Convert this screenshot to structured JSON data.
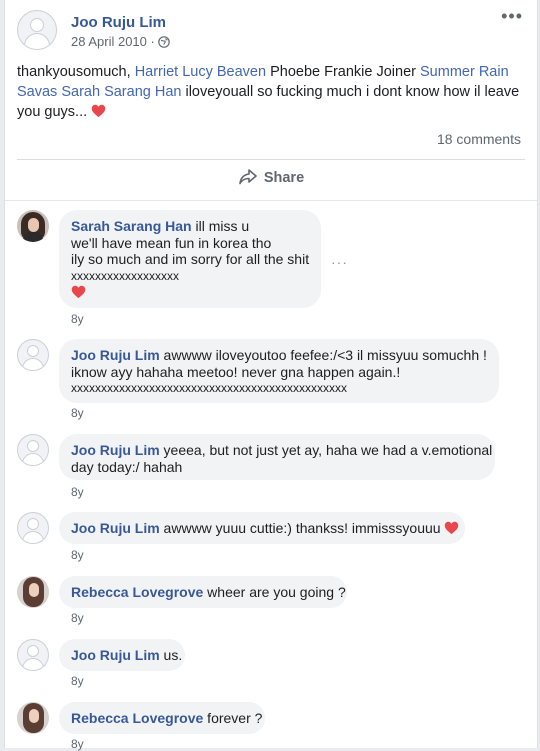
{
  "post": {
    "author": "Joo Ruju Lim",
    "date": "28 April 2010 · ",
    "text_segments": {
      "t1": "thankyousomuch, ",
      "l1": "Harriet Lucy Beaven",
      "t2": " Phoebe Frankie Joiner ",
      "l2": "Summer Rain Savas",
      "t3": " ",
      "l3": "Sarah Sarang Han",
      "t4": " iloveyouall so fucking much i dont know how il leave you guys... "
    },
    "comment_count": "18 comments",
    "share_label": "Share",
    "icons": {
      "more": "more-horizontal-icon",
      "privacy": "globe-icon",
      "share": "share-arrow-icon",
      "heart": "heart-emoji-icon"
    }
  },
  "comments": [
    {
      "author": "Sarah Sarang Han",
      "lines": [
        " ill miss u",
        "we'll have mean fun in korea tho",
        "ily so much and im sorry for all the shit",
        "xxxxxxxxxxxxxxxxxx"
      ],
      "age": "8y"
    },
    {
      "author": "Joo Ruju Lim",
      "lines": [
        " awwww iloveyoutoo feefee:/<3 il missyuu somuchh !",
        "iknow ayy hahaha meetoo! never gna happen again.!",
        "xxxxxxxxxxxxxxxxxxxxxxxxxxxxxxxxxxxxxxxxxxxxxx"
      ],
      "age": "8y"
    },
    {
      "author": "Joo Ruju Lim",
      "lines": [
        " yeeea, but not just yet ay, haha we had a v.emotional",
        "day today:/ hahah"
      ],
      "age": "8y"
    },
    {
      "author": "Joo Ruju Lim",
      "lines": [
        " awwww yuuu cuttie:) thankss! immisssyouuu "
      ],
      "age": "8y"
    },
    {
      "author": "Rebecca Lovegrove",
      "lines": [
        " wheer are you going ?"
      ],
      "age": "8y"
    },
    {
      "author": "Joo Ruju Lim",
      "lines": [
        " us."
      ],
      "age": "8y"
    },
    {
      "author": "Rebecca Lovegrove",
      "lines": [
        " forever ?"
      ],
      "age": "8y"
    }
  ],
  "colors": {
    "link": "#4267b2",
    "author": "#385898",
    "meta": "#606770",
    "bubble": "#f2f3f5",
    "heart": "#e8474b"
  }
}
